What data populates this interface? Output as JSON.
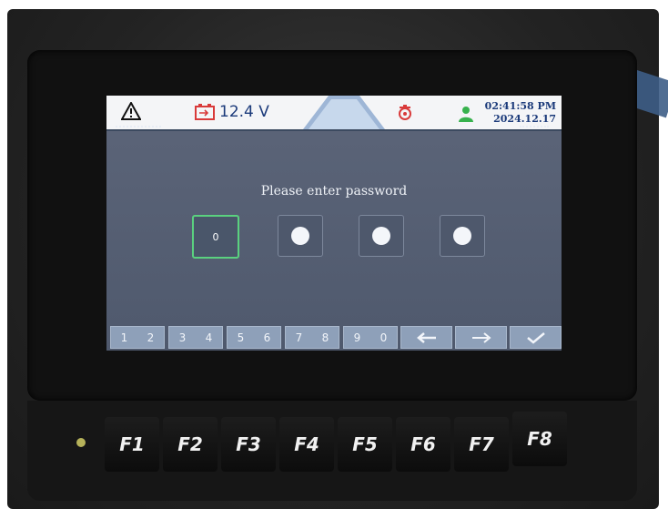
{
  "status_bar": {
    "voltage": "12.4 V",
    "time": "02:41:58 PM",
    "date": "2024.12.17",
    "icons": [
      "warning-icon",
      "battery-icon",
      "engine-warning-icon",
      "operator-icon"
    ],
    "colors": {
      "battery": "#d93a3a",
      "engine": "#d93a3a",
      "operator": "#37b24d",
      "text": "#1b3a7a"
    }
  },
  "prompt": "Please enter password",
  "password": {
    "entered_digit": "0",
    "active_index": 0
  },
  "keypad": {
    "keys": [
      {
        "label": "1 2",
        "a": "1",
        "b": "2"
      },
      {
        "label": "3 4",
        "a": "3",
        "b": "4"
      },
      {
        "label": "5 6",
        "a": "5",
        "b": "6"
      },
      {
        "label": "7 8",
        "a": "7",
        "b": "8"
      },
      {
        "label": "9 0",
        "a": "9",
        "b": "0"
      }
    ],
    "back_icon": "arrow-left-icon",
    "forward_icon": "arrow-right-icon",
    "confirm_icon": "check-icon"
  },
  "function_keys": [
    "F1",
    "F2",
    "F3",
    "F4",
    "F5",
    "F6",
    "F7",
    "F8"
  ]
}
